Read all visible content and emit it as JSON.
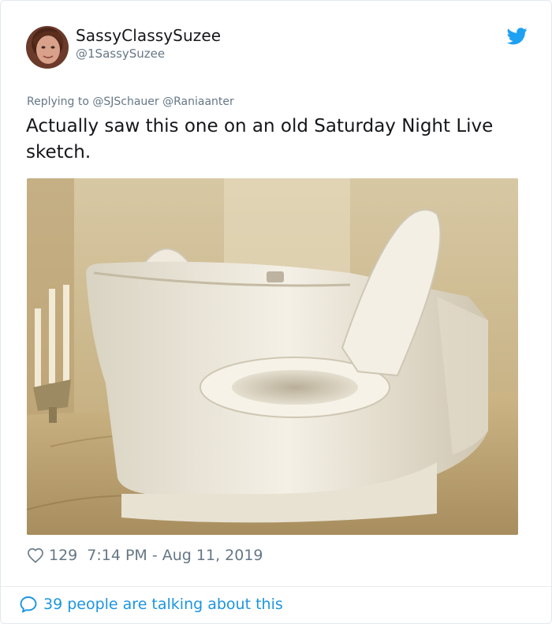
{
  "tweet": {
    "author": {
      "display_name": "SassyClassySuzee",
      "handle": "@1SassySuzee",
      "avatar_icon": "avatar-photo"
    },
    "platform_icon": "twitter-bird-icon",
    "replying_to": "Replying to @SJSchauer @Raniaanter",
    "text": "Actually saw this one on an old Saturday Night Live sketch.",
    "media_icon": "photo-double-toilet",
    "like_count": "129",
    "timestamp": "7:14 PM - Aug 11, 2019",
    "talking_text": "39 people are talking about this"
  },
  "colors": {
    "text": "#14171a",
    "secondary": "#657786",
    "link": "#1b95e0",
    "twitter_blue": "#1da1f2",
    "border": "#e1e8ed"
  }
}
